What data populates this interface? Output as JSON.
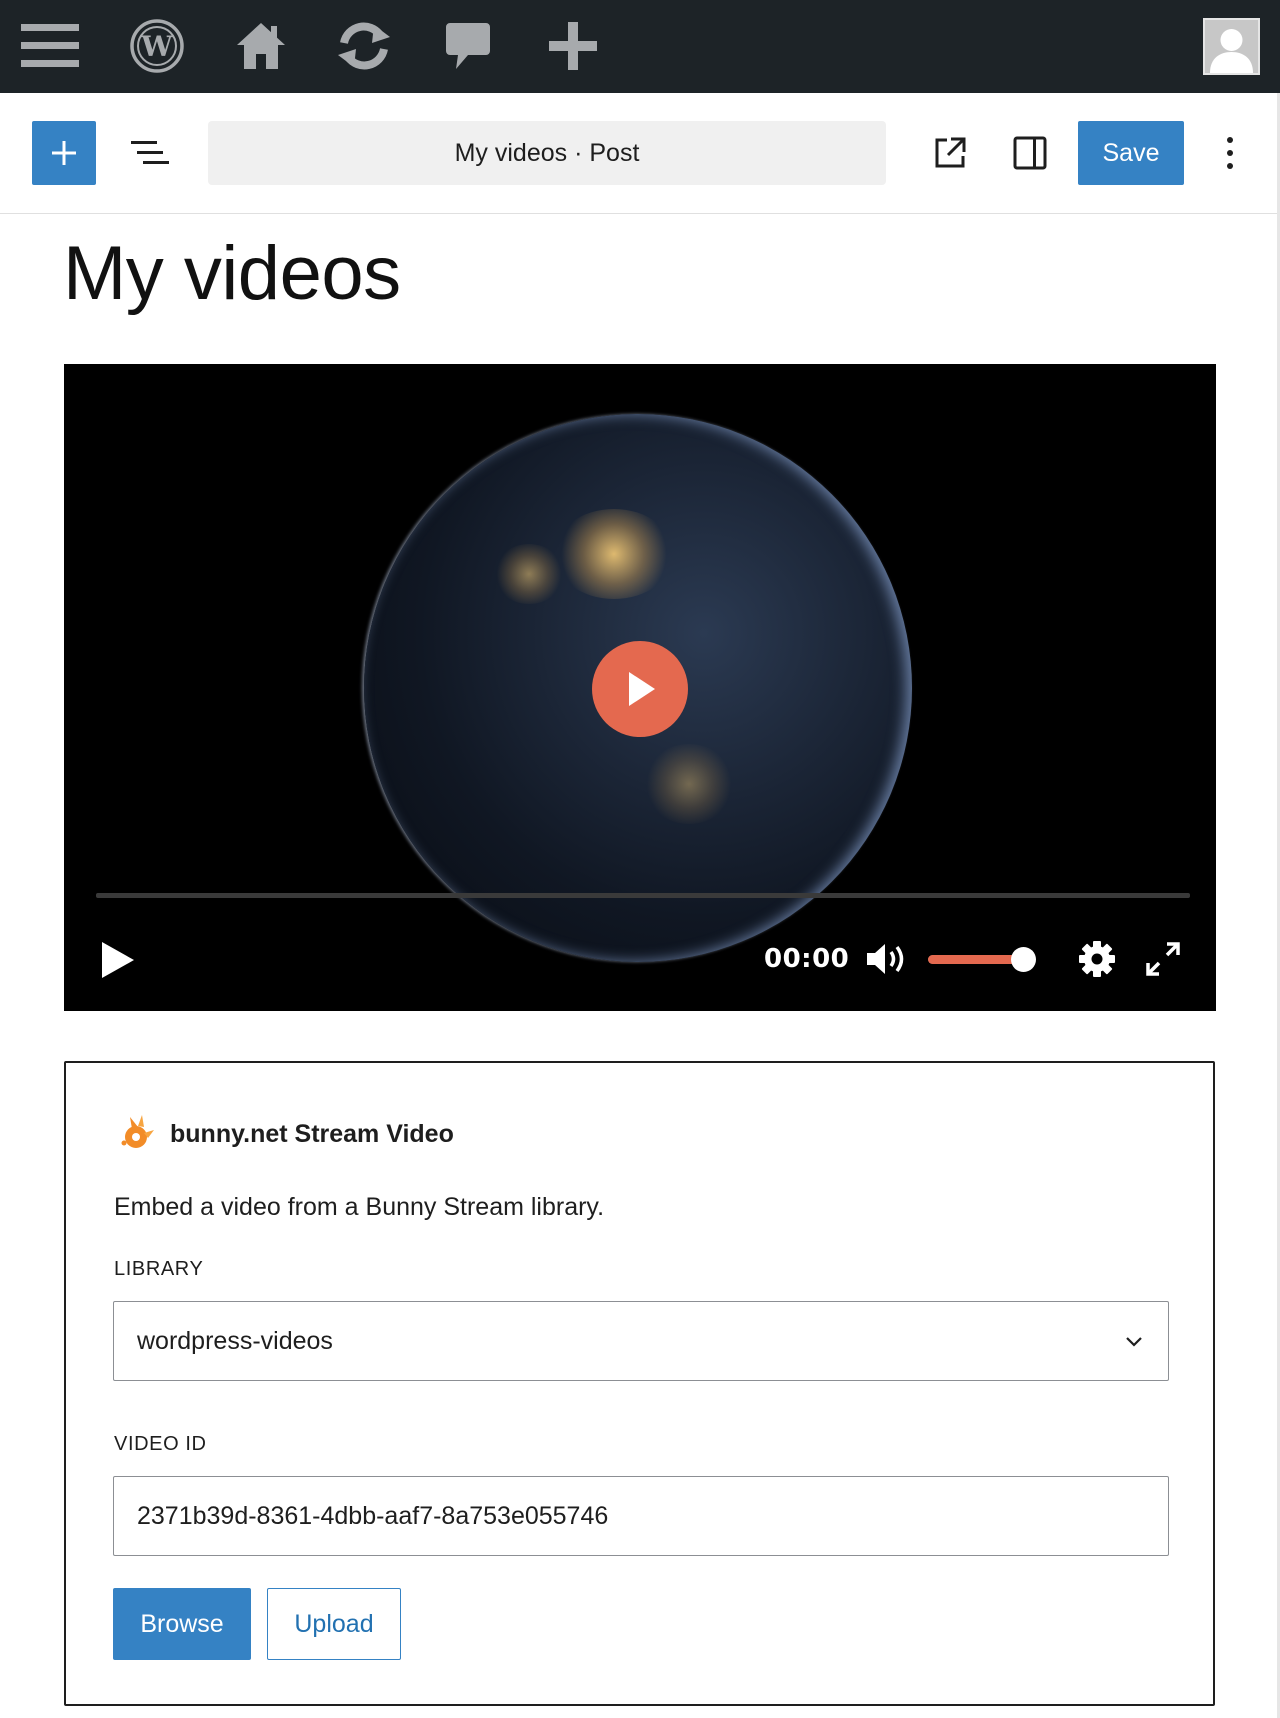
{
  "admin_bar": {
    "icons": [
      "menu-icon",
      "wordpress-logo-icon",
      "home-icon",
      "updates-icon",
      "comments-icon",
      "new-content-icon"
    ],
    "avatar": "user-avatar"
  },
  "editor_header": {
    "document_title": "My videos · Post",
    "save_label": "Save",
    "icons": [
      "plus-icon",
      "list-view-icon",
      "external-link-icon",
      "sidebar-toggle-icon",
      "more-options-icon"
    ]
  },
  "post": {
    "title": "My videos"
  },
  "video_player": {
    "time": "00:00",
    "volume_level": 0.9,
    "progress": 0,
    "accent_color": "#e4694f",
    "controls": [
      "play-icon",
      "volume-icon",
      "settings-icon",
      "fullscreen-icon"
    ]
  },
  "bunny_block": {
    "title": "bunny.net Stream Video",
    "description": "Embed a video from a Bunny Stream library.",
    "library_label": "LIBRARY",
    "library_value": "wordpress-videos",
    "video_id_label": "VIDEO ID",
    "video_id_value": "2371b39d-8361-4dbb-aaf7-8a753e055746",
    "browse_label": "Browse",
    "upload_label": "Upload"
  },
  "colors": {
    "admin_bar": "#1d2327",
    "primary": "#3582c4"
  }
}
